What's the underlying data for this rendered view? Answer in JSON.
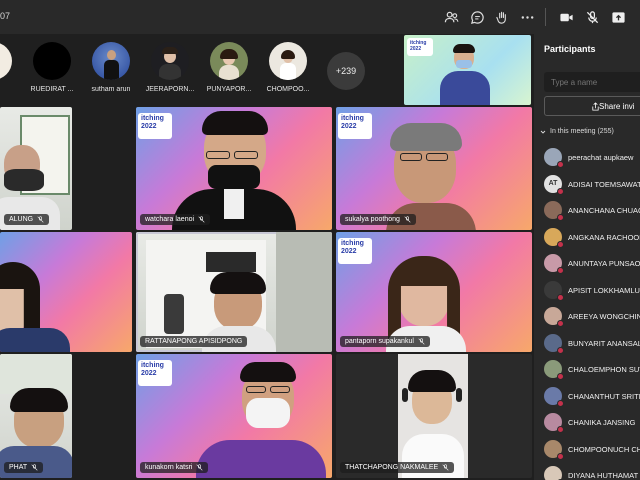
{
  "topbar": {
    "call_time": "07",
    "buttons": [
      {
        "name": "people-button",
        "icon": "people-icon"
      },
      {
        "name": "chat-button",
        "icon": "chat-icon"
      },
      {
        "name": "react-button",
        "icon": "reactions-icon"
      },
      {
        "name": "more-button",
        "icon": "more-icon"
      },
      {
        "name": "camera-button",
        "icon": "camera-icon"
      },
      {
        "name": "mic-button",
        "icon": "mic-off-icon"
      },
      {
        "name": "share-button",
        "icon": "share-tray-icon"
      }
    ]
  },
  "avatar_strip": {
    "items": [
      {
        "label": ""
      },
      {
        "label": "RUEDIRAT ..."
      },
      {
        "label": "sutham arun"
      },
      {
        "label": "JEERAPORN..."
      },
      {
        "label": "PUNYAPOR..."
      },
      {
        "label": "CHOMPOO..."
      }
    ],
    "more_count": "+239"
  },
  "presenter": {
    "brand_top": "itching",
    "brand_year": "2022"
  },
  "tiles": {
    "t1": {
      "name": "ALUNG"
    },
    "t2": {
      "name": "watchara laenoi",
      "brand_top": "itching",
      "brand_year": "2022"
    },
    "t3": {
      "name": "sukalya poothong",
      "brand_top": "itching",
      "brand_year": "2022"
    },
    "t4": {
      "name": ""
    },
    "t5": {
      "name": "RATTANAPONG APISIDPONG"
    },
    "t6": {
      "name": "pantaporn supakankul",
      "brand_top": "itching",
      "brand_year": "2022"
    },
    "t7": {
      "name": "PHAT"
    },
    "t8": {
      "name": "kunakorn katsri",
      "brand_top": "itching",
      "brand_year": "2022"
    },
    "t9": {
      "name": "THATCHAPONG NAKMALEE"
    }
  },
  "panel": {
    "title": "Participants",
    "search_placeholder": "Type a name",
    "share_label": "Share invi",
    "section_label": "In this meeting (255)",
    "participants": [
      {
        "name": "peerachat aupkaew",
        "initials": "",
        "color": "#9aa6b8"
      },
      {
        "name": "ADISAI TOEMSAWATS",
        "initials": "AT",
        "color": "#e2e2e2"
      },
      {
        "name": "ANANCHANA CHUACH",
        "initials": "",
        "color": "#8a6a5a"
      },
      {
        "name": "ANGKANA RACHOOKA",
        "initials": "",
        "color": "#d8a85a"
      },
      {
        "name": "ANUNTAYA PUNSAO",
        "initials": "",
        "color": "#c89aa8"
      },
      {
        "name": "APISIT LOKKHAMLUE",
        "initials": "",
        "color": "#3a3a3a"
      },
      {
        "name": "AREEYA WONGCHINA",
        "initials": "",
        "color": "#c8a898"
      },
      {
        "name": "BUNYARIT ANANSALU",
        "initials": "",
        "color": "#5a6a8a"
      },
      {
        "name": "CHALOEMPHON SUTS",
        "initials": "",
        "color": "#8a9a7a"
      },
      {
        "name": "CHANANTHUT SRITHO",
        "initials": "",
        "color": "#6a7aa8"
      },
      {
        "name": "CHANIKA JANSING",
        "initials": "",
        "color": "#b88aa0"
      },
      {
        "name": "CHOMPOONUCH CHA",
        "initials": "",
        "color": "#a8886a"
      },
      {
        "name": "DIYANA HUTHAMAT",
        "initials": "",
        "color": "#d8c8b8"
      }
    ]
  }
}
